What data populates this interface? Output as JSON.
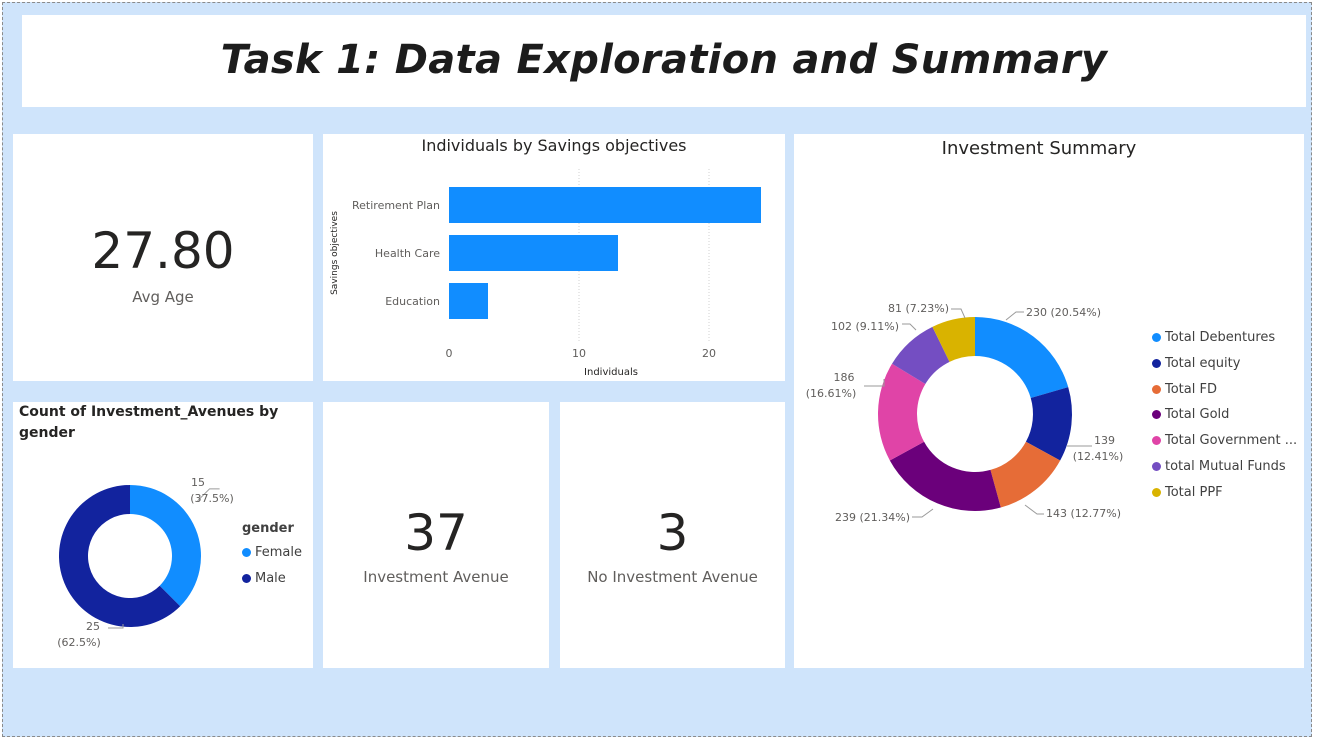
{
  "header": {
    "title": "Task 1: Data Exploration and Summary"
  },
  "kpis": {
    "avg_age": {
      "value": "27.80",
      "label": "Avg Age"
    },
    "investment_avenue": {
      "value": "37",
      "label": "Investment Avenue"
    },
    "no_investment_avenue": {
      "value": "3",
      "label": "No Investment Avenue"
    }
  },
  "colors": {
    "canvas": "#cfe4fb",
    "bar": "#118dff",
    "female": "#118dff",
    "male": "#12239e"
  },
  "chart_data": [
    {
      "id": "savings",
      "type": "bar",
      "orientation": "horizontal",
      "title": "Individuals by Savings objectives",
      "xlabel": "Individuals",
      "ylabel": "Savings objectives",
      "categories": [
        "Retirement Plan",
        "Health Care",
        "Education"
      ],
      "values": [
        24,
        13,
        3
      ],
      "xlim": [
        0,
        25
      ],
      "xticks": [
        "0",
        "10",
        "20"
      ],
      "grid": true
    },
    {
      "id": "gender",
      "type": "pie",
      "style": "donut",
      "title": "Count of Investment_Avenues by gender",
      "legend_title": "gender",
      "legend_position": "right",
      "slices": [
        {
          "name": "Female",
          "value": 15,
          "label_line1": "15",
          "label_line2": "(37.5%)",
          "color": "#118dff"
        },
        {
          "name": "Male",
          "value": 25,
          "label_line1": "25",
          "label_line2": "(62.5%)",
          "color": "#12239e"
        }
      ]
    },
    {
      "id": "investment",
      "type": "pie",
      "style": "donut",
      "title": "Investment Summary",
      "legend_position": "right",
      "slices": [
        {
          "name": "Total Debentures",
          "value": 230,
          "label_line1": "230 (20.54%)",
          "label_line2": "",
          "color": "#118dff"
        },
        {
          "name": "Total equity",
          "value": 139,
          "label_line1": "139",
          "label_line2": "(12.41%)",
          "color": "#12239e"
        },
        {
          "name": "Total FD",
          "value": 143,
          "label_line1": "143 (12.77%)",
          "label_line2": "",
          "color": "#e66c37"
        },
        {
          "name": "Total Gold",
          "value": 239,
          "label_line1": "239 (21.34%)",
          "label_line2": "",
          "color": "#6b007b"
        },
        {
          "name": "Total Government ...",
          "value": 186,
          "label_line1": "186",
          "label_line2": "(16.61%)",
          "color": "#e044a7"
        },
        {
          "name": "total Mutual Funds",
          "value": 102,
          "label_line1": "102 (9.11%)",
          "label_line2": "",
          "color": "#744ec2"
        },
        {
          "name": "Total PPF",
          "value": 81,
          "label_line1": "81 (7.23%)",
          "label_line2": "",
          "color": "#d9b300"
        }
      ]
    }
  ]
}
